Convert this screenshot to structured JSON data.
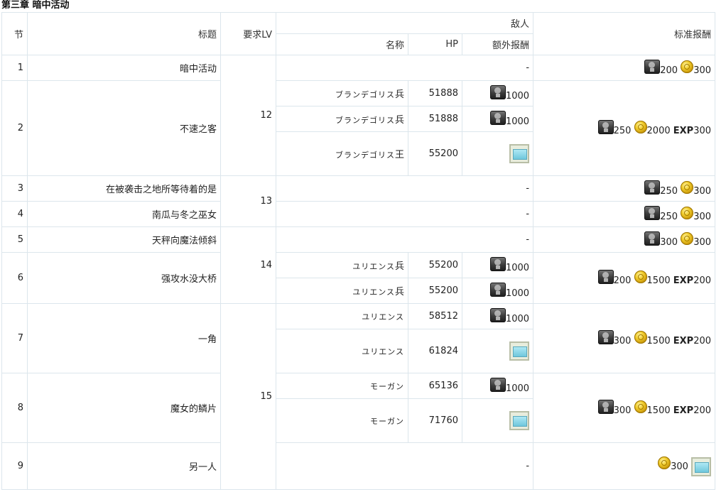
{
  "chapter_title": "第三章 暗中活动",
  "headers": {
    "section": "节",
    "title": "标题",
    "req_lv": "要求LV",
    "enemy": "敌人",
    "name": "名称",
    "hp": "HP",
    "extra_reward": "额外报酬",
    "std_reward": "标准报酬"
  },
  "dash": "-",
  "exp_label": "EXP",
  "levels": {
    "l12": "12",
    "l13": "13",
    "l14": "14",
    "l15": "15"
  },
  "rows": {
    "s1": {
      "num": "1",
      "title": "暗中活动",
      "spirit": "200",
      "gold": "300"
    },
    "s2": {
      "num": "2",
      "title": "不速之客",
      "spirit": "250",
      "gold": "2000",
      "exp": "300",
      "enemies": [
        {
          "name": "ブランデゴリス",
          "suffix": "兵",
          "hp": "51888",
          "extra": "1000"
        },
        {
          "name": "ブランデゴリス",
          "suffix": "兵",
          "hp": "51888",
          "extra": "1000"
        },
        {
          "name": "ブランデゴリス",
          "suffix": "王",
          "hp": "55200"
        }
      ]
    },
    "s3": {
      "num": "3",
      "title": "在被袭击之地所等待着的是",
      "spirit": "250",
      "gold": "300"
    },
    "s4": {
      "num": "4",
      "title": "南瓜与冬之巫女",
      "spirit": "250",
      "gold": "300"
    },
    "s5": {
      "num": "5",
      "title": "天秤向魔法倾斜",
      "spirit": "300",
      "gold": "300"
    },
    "s6": {
      "num": "6",
      "title": "强攻水没大桥",
      "spirit": "200",
      "gold": "1500",
      "exp": "200",
      "enemies": [
        {
          "name": "ユリエンス",
          "suffix": "兵",
          "hp": "55200",
          "extra": "1000"
        },
        {
          "name": "ユリエンス",
          "suffix": "兵",
          "hp": "55200",
          "extra": "1000"
        }
      ]
    },
    "s7": {
      "num": "7",
      "title": "一角",
      "spirit": "300",
      "gold": "1500",
      "exp": "200",
      "enemies": [
        {
          "name": "ユリエンス",
          "hp": "58512",
          "extra": "1000"
        },
        {
          "name": "ユリエンス",
          "hp": "61824"
        }
      ]
    },
    "s8": {
      "num": "8",
      "title": "魔女的鳞片",
      "spirit": "300",
      "gold": "1500",
      "exp": "200",
      "enemies": [
        {
          "name": "モーガン",
          "hp": "65136",
          "extra": "1000"
        },
        {
          "name": "モーガン",
          "hp": "71760"
        }
      ]
    },
    "s9": {
      "num": "9",
      "title": "另一人",
      "gold": "300"
    }
  },
  "icons": {
    "spirit": "spirit-gem-icon",
    "gold": "gold-coin-icon",
    "ticket": "ticket-card-icon"
  }
}
